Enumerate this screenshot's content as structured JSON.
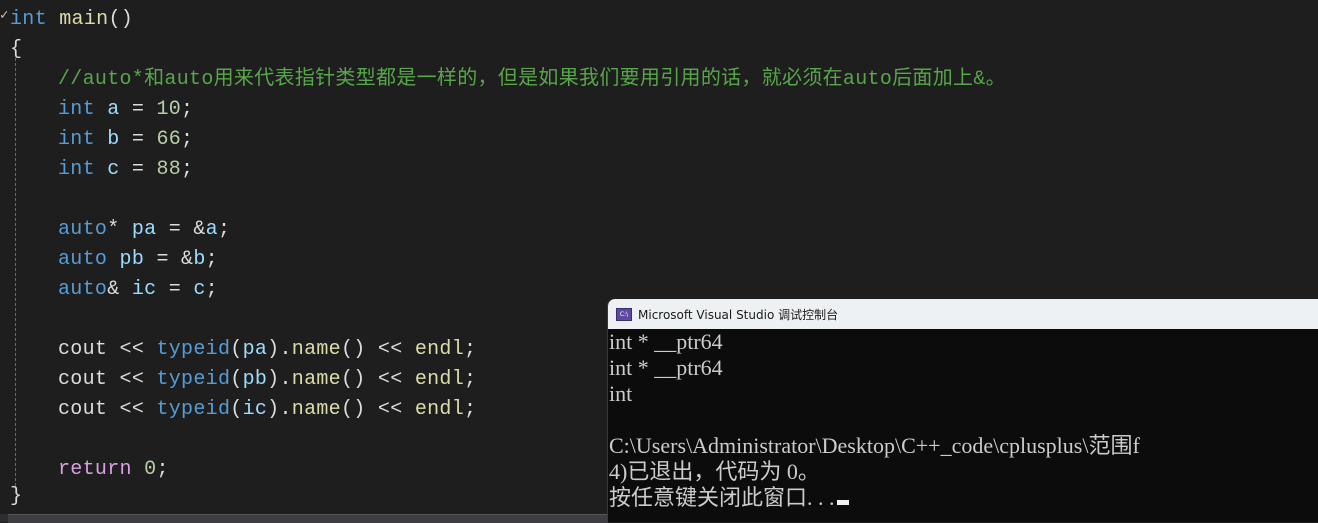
{
  "editor": {
    "lines": [
      {
        "tokens": [
          {
            "t": "int",
            "c": "kw"
          },
          {
            "t": " ",
            "c": "plain"
          },
          {
            "t": "main",
            "c": "fn"
          },
          {
            "t": "()",
            "c": "plain"
          }
        ]
      },
      {
        "tokens": [
          {
            "t": "{",
            "c": "plain"
          }
        ]
      },
      {
        "tokens": [
          {
            "t": "//auto*和auto用来代表指针类型都是一样的，但是如果我们要用引用的话，就必须在auto后面加上&。",
            "c": "cmt"
          }
        ]
      },
      {
        "tokens": [
          {
            "t": "int",
            "c": "kw"
          },
          {
            "t": " ",
            "c": "plain"
          },
          {
            "t": "a",
            "c": "var"
          },
          {
            "t": " = ",
            "c": "plain"
          },
          {
            "t": "10",
            "c": "num"
          },
          {
            "t": ";",
            "c": "plain"
          }
        ]
      },
      {
        "tokens": [
          {
            "t": "int",
            "c": "kw"
          },
          {
            "t": " ",
            "c": "plain"
          },
          {
            "t": "b",
            "c": "var"
          },
          {
            "t": " = ",
            "c": "plain"
          },
          {
            "t": "66",
            "c": "num"
          },
          {
            "t": ";",
            "c": "plain"
          }
        ]
      },
      {
        "tokens": [
          {
            "t": "int",
            "c": "kw"
          },
          {
            "t": " ",
            "c": "plain"
          },
          {
            "t": "c",
            "c": "var"
          },
          {
            "t": " = ",
            "c": "plain"
          },
          {
            "t": "88",
            "c": "num"
          },
          {
            "t": ";",
            "c": "plain"
          }
        ]
      },
      {
        "tokens": []
      },
      {
        "tokens": [
          {
            "t": "auto",
            "c": "kw"
          },
          {
            "t": "* ",
            "c": "plain"
          },
          {
            "t": "pa",
            "c": "var"
          },
          {
            "t": " = &",
            "c": "plain"
          },
          {
            "t": "a",
            "c": "var"
          },
          {
            "t": ";",
            "c": "plain"
          }
        ]
      },
      {
        "tokens": [
          {
            "t": "auto",
            "c": "kw"
          },
          {
            "t": " ",
            "c": "plain"
          },
          {
            "t": "pb",
            "c": "var"
          },
          {
            "t": " = &",
            "c": "plain"
          },
          {
            "t": "b",
            "c": "var"
          },
          {
            "t": ";",
            "c": "plain"
          }
        ]
      },
      {
        "tokens": [
          {
            "t": "auto",
            "c": "kw"
          },
          {
            "t": "& ",
            "c": "plain"
          },
          {
            "t": "ic",
            "c": "var"
          },
          {
            "t": " = ",
            "c": "plain"
          },
          {
            "t": "c",
            "c": "var"
          },
          {
            "t": ";",
            "c": "plain"
          }
        ]
      },
      {
        "tokens": []
      },
      {
        "tokens": [
          {
            "t": "cout",
            "c": "plain"
          },
          {
            "t": " << ",
            "c": "plain"
          },
          {
            "t": "typeid",
            "c": "kw"
          },
          {
            "t": "(",
            "c": "plain"
          },
          {
            "t": "pa",
            "c": "var"
          },
          {
            "t": ").",
            "c": "plain"
          },
          {
            "t": "name",
            "c": "fn"
          },
          {
            "t": "() << ",
            "c": "plain"
          },
          {
            "t": "endl",
            "c": "fn"
          },
          {
            "t": ";",
            "c": "plain"
          }
        ]
      },
      {
        "tokens": [
          {
            "t": "cout",
            "c": "plain"
          },
          {
            "t": " << ",
            "c": "plain"
          },
          {
            "t": "typeid",
            "c": "kw"
          },
          {
            "t": "(",
            "c": "plain"
          },
          {
            "t": "pb",
            "c": "var"
          },
          {
            "t": ").",
            "c": "plain"
          },
          {
            "t": "name",
            "c": "fn"
          },
          {
            "t": "() << ",
            "c": "plain"
          },
          {
            "t": "endl",
            "c": "fn"
          },
          {
            "t": ";",
            "c": "plain"
          }
        ]
      },
      {
        "tokens": [
          {
            "t": "cout",
            "c": "plain"
          },
          {
            "t": " << ",
            "c": "plain"
          },
          {
            "t": "typeid",
            "c": "kw"
          },
          {
            "t": "(",
            "c": "plain"
          },
          {
            "t": "ic",
            "c": "var"
          },
          {
            "t": ").",
            "c": "plain"
          },
          {
            "t": "name",
            "c": "fn"
          },
          {
            "t": "() << ",
            "c": "plain"
          },
          {
            "t": "endl",
            "c": "fn"
          },
          {
            "t": ";",
            "c": "plain"
          }
        ]
      },
      {
        "tokens": []
      },
      {
        "tokens": [
          {
            "t": "return",
            "c": "ret"
          },
          {
            "t": " ",
            "c": "plain"
          },
          {
            "t": "0",
            "c": "num"
          },
          {
            "t": ";",
            "c": "plain"
          }
        ]
      },
      {
        "tokens": [
          {
            "t": "}",
            "c": "plain"
          }
        ]
      }
    ]
  },
  "console": {
    "icon_label": "C:\\",
    "title": "Microsoft Visual Studio 调试控制台",
    "output": [
      "int * __ptr64",
      "int * __ptr64",
      "int",
      "",
      "C:\\Users\\Administrator\\Desktop\\C++_code\\cplusplus\\范围f",
      "4)已退出，代码为 0。",
      "按任意键关闭此窗口. . ."
    ]
  },
  "icons": {
    "fold": "collapse-marker-icon",
    "console": "console-app-icon"
  }
}
